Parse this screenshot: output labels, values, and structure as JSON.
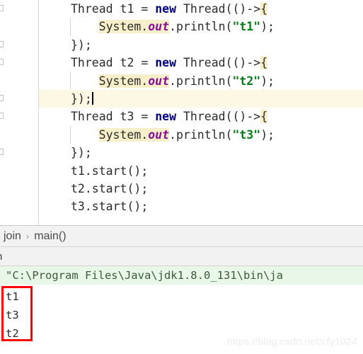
{
  "editor": {
    "lines": [
      {
        "indent": 0,
        "tokens": [
          {
            "t": "Thread t1 = ",
            "c": "plain"
          },
          {
            "t": "new",
            "c": "kw"
          },
          {
            "t": " Thread(()->",
            "c": "plain"
          },
          {
            "t": "{",
            "c": "brace-hl"
          }
        ]
      },
      {
        "indent": 1,
        "tokens": [
          {
            "t": "System.",
            "c": "hl"
          },
          {
            "t": "out",
            "c": "field hl"
          },
          {
            "t": ".println(",
            "c": "plain"
          },
          {
            "t": "\"t1\"",
            "c": "str"
          },
          {
            "t": ");",
            "c": "plain"
          }
        ]
      },
      {
        "indent": 0,
        "tokens": [
          {
            "t": "});",
            "c": "plain"
          }
        ]
      },
      {
        "indent": 0,
        "tokens": [
          {
            "t": "Thread t2 = ",
            "c": "plain"
          },
          {
            "t": "new",
            "c": "kw"
          },
          {
            "t": " Thread(()->",
            "c": "plain"
          },
          {
            "t": "{",
            "c": "brace-hl"
          }
        ]
      },
      {
        "indent": 1,
        "tokens": [
          {
            "t": "System.",
            "c": "hl"
          },
          {
            "t": "out",
            "c": "field hl"
          },
          {
            "t": ".println(",
            "c": "plain"
          },
          {
            "t": "\"t2\"",
            "c": "str"
          },
          {
            "t": ");",
            "c": "plain"
          }
        ]
      },
      {
        "indent": 0,
        "current": true,
        "caret": true,
        "tokens": [
          {
            "t": "});",
            "c": "plain"
          }
        ]
      },
      {
        "indent": 0,
        "tokens": [
          {
            "t": "Thread t3 = ",
            "c": "plain"
          },
          {
            "t": "new",
            "c": "kw"
          },
          {
            "t": " Thread(()->",
            "c": "plain"
          },
          {
            "t": "{",
            "c": "brace-hl"
          }
        ]
      },
      {
        "indent": 1,
        "tokens": [
          {
            "t": "System.",
            "c": "hl"
          },
          {
            "t": "out",
            "c": "field hl"
          },
          {
            "t": ".println(",
            "c": "plain"
          },
          {
            "t": "\"t3\"",
            "c": "str"
          },
          {
            "t": ");",
            "c": "plain"
          }
        ]
      },
      {
        "indent": 0,
        "tokens": [
          {
            "t": "});",
            "c": "plain"
          }
        ]
      },
      {
        "indent": 0,
        "tokens": [
          {
            "t": "t1.start();",
            "c": "plain"
          }
        ]
      },
      {
        "indent": 0,
        "tokens": [
          {
            "t": "t2.start();",
            "c": "plain"
          }
        ]
      },
      {
        "indent": 0,
        "tokens": [
          {
            "t": "t3.start();",
            "c": "plain"
          }
        ]
      }
    ],
    "fold_marker_rows": [
      0,
      2,
      3,
      5,
      6,
      8
    ],
    "current_line_index": 5
  },
  "breadcrumb": {
    "items": [
      "join",
      "main()"
    ],
    "separator": "›"
  },
  "run_toolbar": {
    "clipped_label": "n"
  },
  "console": {
    "command": "\"C:\\Program Files\\Java\\jdk1.8.0_131\\bin\\ja",
    "output": [
      "t1",
      "t3",
      "t2"
    ]
  },
  "watermark": {
    "text": "https://blog.csdn.net/cfy1024"
  },
  "colors": {
    "keyword": "#000080",
    "field": "#871094",
    "string": "#067d17",
    "highlight": "#f7eeca",
    "current_line": "#fdf8e3",
    "command_bg": "#e9f7e9",
    "box_outline": "#ff0000"
  }
}
